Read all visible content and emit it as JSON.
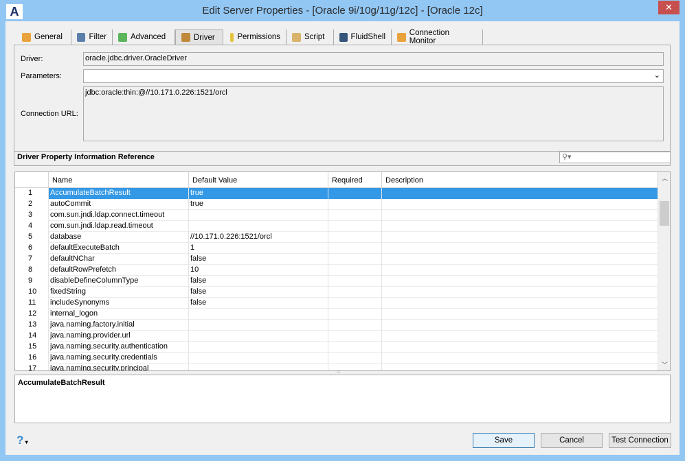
{
  "window": {
    "title": "Edit Server Properties - [Oracle 9i/10g/11g/12c] - [Oracle 12c]",
    "logo": "A",
    "close": "✕"
  },
  "tabs": [
    {
      "label": "General",
      "icon": "general-icon",
      "color": "#e8a33c"
    },
    {
      "label": "Filter",
      "icon": "filter-icon",
      "color": "#5b7fa8"
    },
    {
      "label": "Advanced",
      "icon": "advanced-icon",
      "color": "#5bb55b"
    },
    {
      "label": "Driver",
      "icon": "driver-icon",
      "color": "#c08a3c"
    },
    {
      "label": "Permissions",
      "icon": "permissions-icon",
      "color": "#e6c23c"
    },
    {
      "label": "Script",
      "icon": "script-icon",
      "color": "#d9b36b"
    },
    {
      "label": "FluidShell",
      "icon": "fluidshell-icon",
      "color": "#35557a"
    },
    {
      "label": "Connection Monitor",
      "icon": "connection-monitor-icon",
      "color": "#e8a33c"
    }
  ],
  "form": {
    "driver_label": "Driver:",
    "driver_value": "oracle.jdbc.driver.OracleDriver",
    "parameters_label": "Parameters:",
    "parameters_value": "",
    "url_label": "Connection URL:",
    "url_value": "jdbc:oracle:thin:@//10.171.0.226:1521/orcl"
  },
  "section": {
    "title": "Driver Property Information Reference",
    "search_placeholder": ""
  },
  "table": {
    "columns": [
      "Name",
      "Default Value",
      "Required",
      "Description"
    ],
    "rows": [
      {
        "n": "1",
        "name": "AccumulateBatchResult",
        "def": "true"
      },
      {
        "n": "2",
        "name": "autoCommit",
        "def": "true"
      },
      {
        "n": "3",
        "name": "com.sun.jndi.ldap.connect.timeout",
        "def": ""
      },
      {
        "n": "4",
        "name": "com.sun.jndi.ldap.read.timeout",
        "def": ""
      },
      {
        "n": "5",
        "name": "database",
        "def": "//10.171.0.226:1521/orcl"
      },
      {
        "n": "6",
        "name": "defaultExecuteBatch",
        "def": "1"
      },
      {
        "n": "7",
        "name": "defaultNChar",
        "def": "false"
      },
      {
        "n": "8",
        "name": "defaultRowPrefetch",
        "def": "10"
      },
      {
        "n": "9",
        "name": "disableDefineColumnType",
        "def": "false"
      },
      {
        "n": "10",
        "name": "fixedString",
        "def": "false"
      },
      {
        "n": "11",
        "name": "includeSynonyms",
        "def": "false"
      },
      {
        "n": "12",
        "name": "internal_logon",
        "def": ""
      },
      {
        "n": "13",
        "name": "java.naming.factory.initial",
        "def": ""
      },
      {
        "n": "14",
        "name": "java.naming.provider.url",
        "def": ""
      },
      {
        "n": "15",
        "name": "java.naming.security.authentication",
        "def": ""
      },
      {
        "n": "16",
        "name": "java.naming.security.credentials",
        "def": ""
      },
      {
        "n": "17",
        "name": "java.naming.security.principal",
        "def": ""
      }
    ]
  },
  "description": "AccumulateBatchResult",
  "buttons": {
    "help": "?",
    "save": "Save",
    "cancel": "Cancel",
    "test": "Test Connection"
  }
}
